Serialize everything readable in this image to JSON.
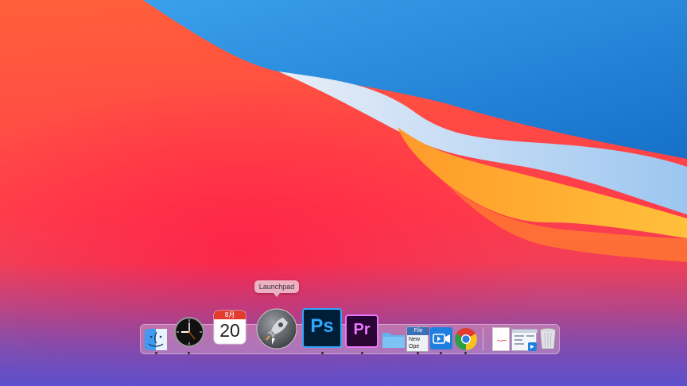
{
  "wallpaper": {
    "name": "macOS Big Sur"
  },
  "tooltip": {
    "label": "Launchpad"
  },
  "dock": {
    "apps": [
      {
        "id": "finder",
        "icon": "finder-icon",
        "running": true
      },
      {
        "id": "clock",
        "icon": "clock-icon",
        "running": true
      },
      {
        "id": "calendar",
        "icon": "calendar-icon",
        "month": "8月",
        "day": "20",
        "running": false
      },
      {
        "id": "launchpad",
        "icon": "launchpad-icon",
        "running": false,
        "hovered": true
      },
      {
        "id": "photoshop",
        "icon": "photoshop-icon",
        "label": "Ps",
        "running": true
      },
      {
        "id": "premiere",
        "icon": "premiere-icon",
        "label": "Pr",
        "running": true
      },
      {
        "id": "folder",
        "icon": "folder-icon",
        "running": false
      },
      {
        "id": "file-new-open",
        "icon": "file-menu-icon",
        "lines": [
          "File",
          "New",
          "Ope"
        ],
        "running": true
      },
      {
        "id": "video-capture",
        "icon": "video-camera-icon",
        "running": true
      },
      {
        "id": "chrome",
        "icon": "chrome-icon",
        "running": true
      },
      {
        "id": "document",
        "icon": "document-icon",
        "running": false
      },
      {
        "id": "window-capture",
        "icon": "window-capture-icon",
        "running": false
      },
      {
        "id": "trash",
        "icon": "trash-icon",
        "running": false
      }
    ]
  },
  "colors": {
    "photoshop_bg": "#001e36",
    "photoshop_accent": "#31a8ff",
    "premiere_bg": "#2a0634",
    "premiere_accent": "#ea77ff"
  }
}
